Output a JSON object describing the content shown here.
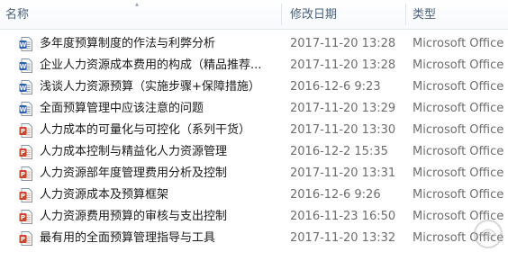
{
  "columns": {
    "name": "名称",
    "date": "修改日期",
    "type": "类型"
  },
  "files": [
    {
      "name": "多年度预算制度的作法与利弊分析",
      "date": "2017-11-20 13:28",
      "type": "Microsoft Office",
      "icon": "word-doc-icon"
    },
    {
      "name": "企业人力资源成本费用的构成（精品推荐...",
      "date": "2017-11-20 13:28",
      "type": "Microsoft Office",
      "icon": "word-doc-icon"
    },
    {
      "name": "浅谈人力资源预算（实施步骤+保障措施）",
      "date": "2016-12-6 9:23",
      "type": "Microsoft Office",
      "icon": "word-doc-icon"
    },
    {
      "name": "全面预算管理中应该注意的问题",
      "date": "2017-11-20 13:29",
      "type": "Microsoft Office",
      "icon": "word-doc-icon"
    },
    {
      "name": "人力成本的可量化与可控化（系列干货）",
      "date": "2017-11-20 13:30",
      "type": "Microsoft Office",
      "icon": "powerpoint-doc-icon"
    },
    {
      "name": "人力成本控制与精益化人力资源管理",
      "date": "2016-12-2 15:35",
      "type": "Microsoft Office",
      "icon": "powerpoint-doc-icon"
    },
    {
      "name": "人力资源部年度管理费用分析及控制",
      "date": "2017-11-20 13:31",
      "type": "Microsoft Office",
      "icon": "powerpoint-doc-icon"
    },
    {
      "name": "人力资源成本及预算框架",
      "date": "2016-12-6 9:26",
      "type": "Microsoft Office",
      "icon": "powerpoint-doc-icon"
    },
    {
      "name": "人力资源费用预算的审核与支出控制",
      "date": "2016-11-23 16:50",
      "type": "Microsoft Office",
      "icon": "powerpoint-doc-icon"
    },
    {
      "name": "最有用的全面预算管理指导与工具",
      "date": "2017-11-20 13:32",
      "type": "Microsoft Office",
      "icon": "powerpoint-doc-icon"
    }
  ],
  "colors": {
    "header_text": "#4c607a",
    "word_blue": "#2f5faf",
    "ppt_red": "#c9452b"
  }
}
